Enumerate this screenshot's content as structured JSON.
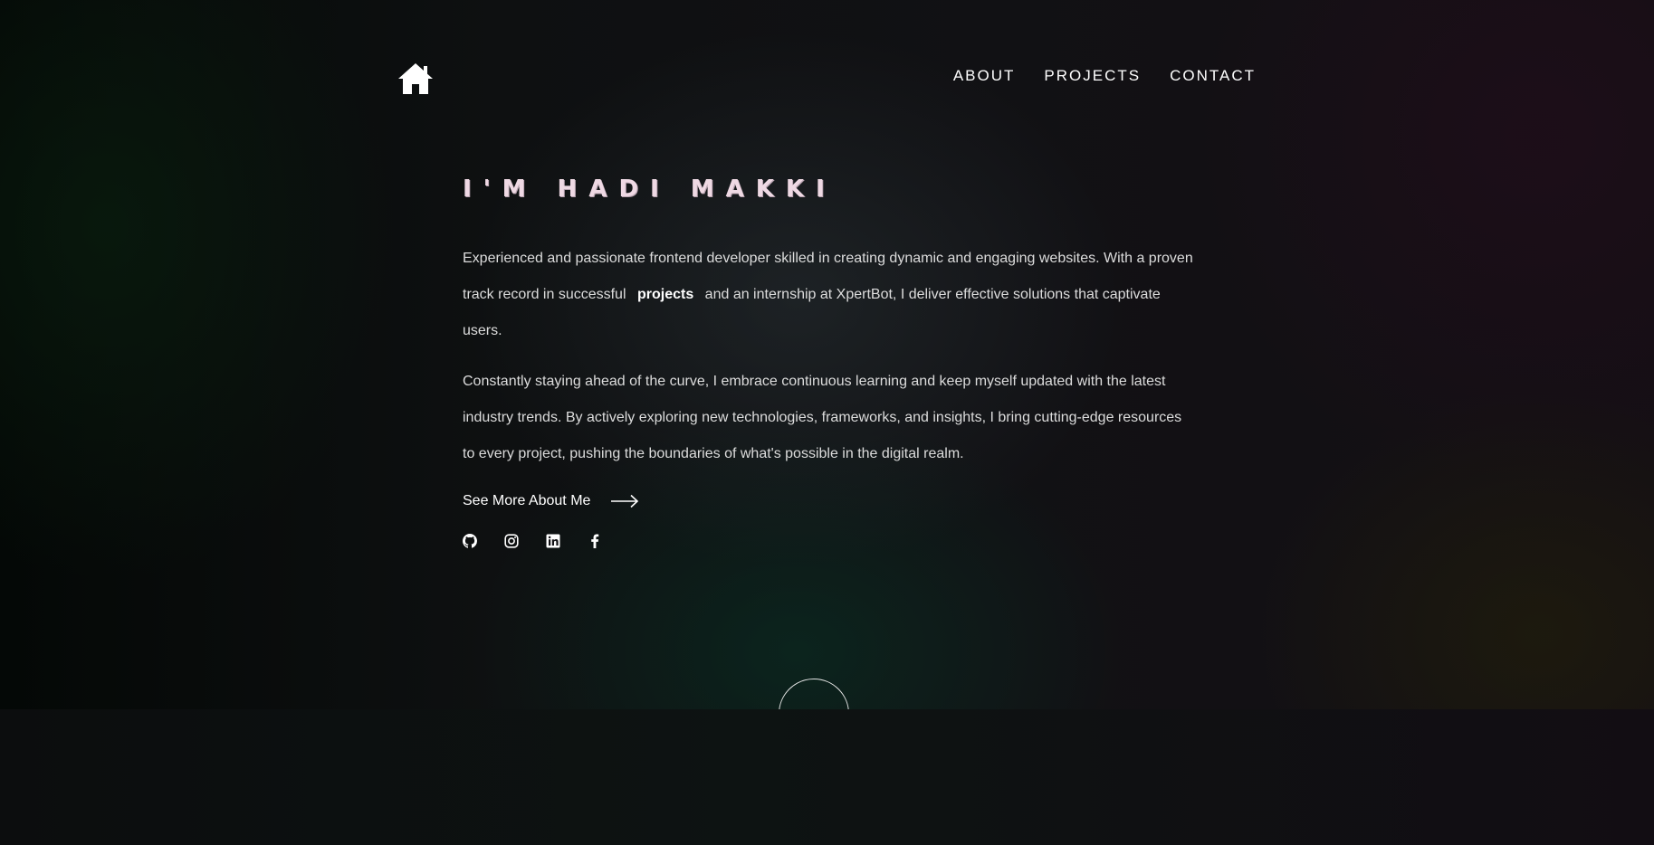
{
  "nav": {
    "home_icon": "home-icon",
    "links": [
      "ABOUT",
      "PROJECTS",
      "CONTACT"
    ]
  },
  "hero": {
    "headline": "I'M HADI MAKKI",
    "para1_before": "Experienced and passionate frontend developer skilled in creating dynamic and engaging websites. With a proven track record in successful",
    "para1_link": "projects",
    "para1_after": "and an internship at XpertBot, I deliver effective solutions that captivate users.",
    "para2": "Constantly staying ahead of the curve, I embrace continuous learning and keep myself updated with the latest industry trends. By actively exploring new technologies, frameworks, and insights, I bring cutting-edge resources to every project, pushing the boundaries of what's possible in the digital realm.",
    "cta_label": "See More About Me",
    "cta_icon": "arrow-right-icon"
  },
  "socials": [
    "github-icon",
    "instagram-icon",
    "linkedin-icon",
    "facebook-icon"
  ],
  "scroll_indicator_icon": "circle-scroll-indicator",
  "colors": {
    "headline": "#efd9e4",
    "text": "#dcdcdc",
    "accent": "#ffffff"
  }
}
